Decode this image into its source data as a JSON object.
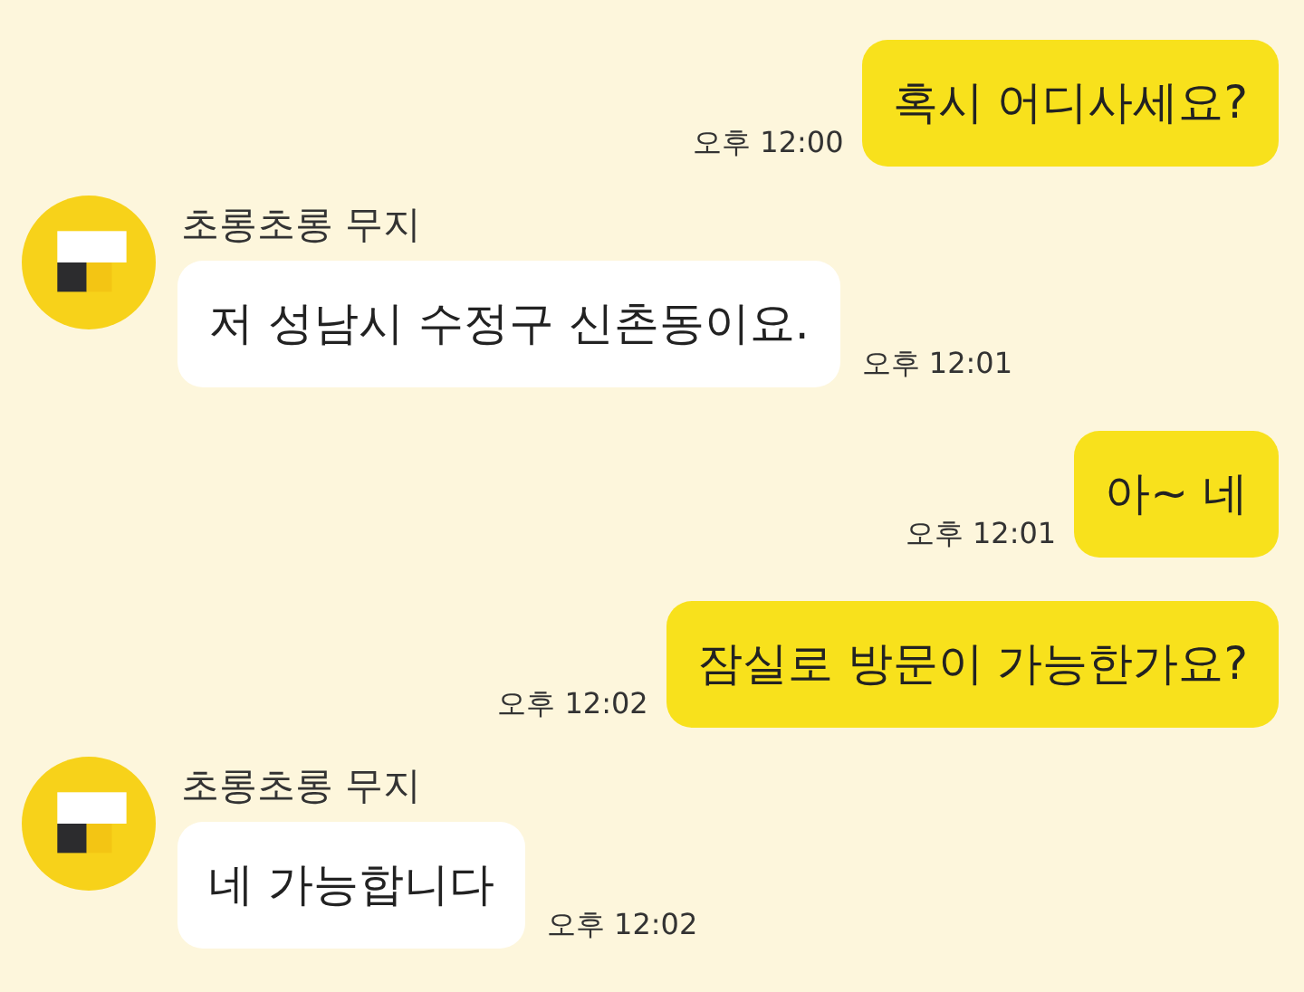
{
  "messages": [
    {
      "kind": "sent",
      "text": "혹시 어디사세요?",
      "time": "오후 12:00"
    },
    {
      "kind": "received",
      "sender": "초롱초롱 무지",
      "text": "저 성남시 수정구 신촌동이요.",
      "time": "오후 12:01"
    },
    {
      "kind": "sent",
      "text": "아~ 네",
      "time": "오후 12:01"
    },
    {
      "kind": "sent",
      "text": "잠실로 방문이 가능한가요?",
      "time": "오후 12:02"
    },
    {
      "kind": "received",
      "sender": "초롱초롱 무지",
      "text": "네 가능합니다",
      "time": "오후 12:02"
    }
  ]
}
